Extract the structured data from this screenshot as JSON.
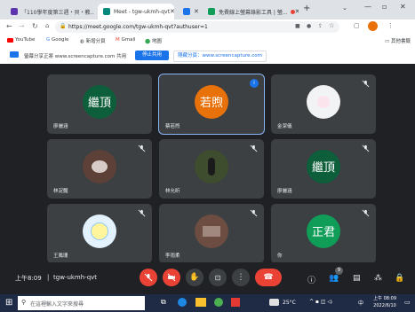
{
  "tabs": [
    {
      "title": "「110學年度第三週・貝・教...」",
      "color": "#9aa0a6"
    },
    {
      "title": "Meet - tgw-ukmh-qvt",
      "color": "#00897b"
    },
    {
      "title": "",
      "color": "#1a73e8"
    },
    {
      "title": "免費線上螢幕錄影工具 | 螢...",
      "color": "#0f9d58"
    }
  ],
  "toolbar": {
    "url": "https://meet.google.com/tgw-ukmh-qvt?authuser=1"
  },
  "bookmarks": [
    "YouTube",
    "Google",
    "新增分頁",
    "Gmail",
    "地圖"
  ],
  "bookmarks_right": "其他書籤",
  "share_bar": {
    "message": "螢幕分享正將 www.screencapture.com 共用",
    "stop_label": "停止共用",
    "hide_label": "隱藏分頁：www.screencapture.com"
  },
  "participants": [
    {
      "name": "廖儷涵",
      "avatar_text": "繼頂",
      "avatar_color": "#0d5e3b",
      "muted": false
    },
    {
      "name": "蔡若煦",
      "avatar_text": "若煦",
      "avatar_color": "#e8710a",
      "muted": false,
      "speaking": true
    },
    {
      "name": "金潔儀",
      "avatar_text": "",
      "avatar_color": "#f1f3f4",
      "muted": true
    },
    {
      "name": "林浞豔",
      "avatar_text": "",
      "avatar_color": "#5d4037",
      "muted": true
    },
    {
      "name": "林允昕",
      "avatar_text": "",
      "avatar_color": "#3e4d2e",
      "muted": true
    },
    {
      "name": "廖儷涵",
      "avatar_text": "繼頂",
      "avatar_color": "#0d5e3b",
      "muted": true
    },
    {
      "name": "王鳳珊",
      "avatar_text": "",
      "avatar_color": "#e3f2fd",
      "muted": true
    },
    {
      "name": "李雨柔",
      "avatar_text": "",
      "avatar_color": "#6d4c41",
      "muted": true
    },
    {
      "name": "你",
      "avatar_text": "正君",
      "avatar_color": "#0f9d58",
      "muted": true
    }
  ],
  "meeting": {
    "time": "上午8:09",
    "separator": "|",
    "code": "tgw-ukmh-qvt"
  },
  "people_badge": "9",
  "taskbar": {
    "search_placeholder": "在這裡輸入文字來搜尋",
    "weather": "25°C",
    "time": "上午 08:09",
    "date": "2022/6/10",
    "ime": "中"
  },
  "colors": {
    "accent": "#8ab4f8",
    "end_call": "#ea4335"
  }
}
